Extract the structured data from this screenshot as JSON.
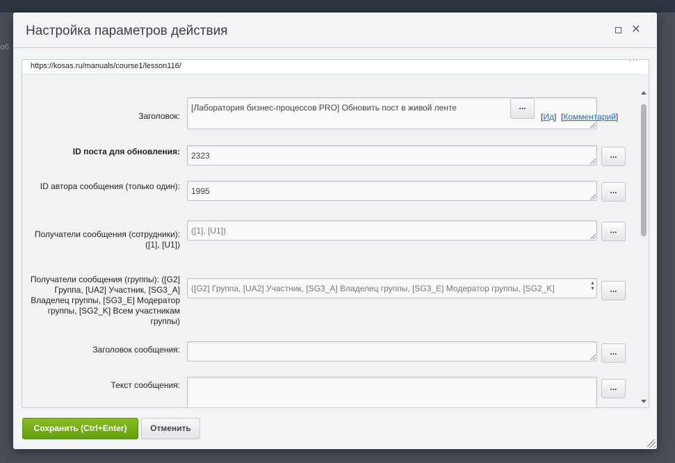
{
  "background": {
    "partial_text": "лоб"
  },
  "dialog": {
    "title": "Настройка параметров действия",
    "maximize_glyph": "□",
    "close_glyph": "✕",
    "dots_glyph": "···"
  },
  "url": "https://kosas.ru/manuals/course1/lesson116/",
  "fields": {
    "title": {
      "label": "Заголовок:",
      "value": "[Лаборатория бизнес-процессов PRO] Обновить пост в живой ленте",
      "button": "...",
      "link_id": "Ид",
      "link_comment": "Комментарий"
    },
    "post_id": {
      "label": "ID поста для обновления:",
      "value": "2323",
      "button": "..."
    },
    "author_id": {
      "label": "ID автора сообщения (только один):",
      "value": "1995",
      "button": "..."
    },
    "recipients_users": {
      "label": "Получатели сообщения (сотрудники): ([1], [U1])",
      "placeholder": "([1], [U1])",
      "button": "..."
    },
    "recipients_groups": {
      "label": "Получатели сообщения (группы): ([G2] Группа, [UA2] Участник, [SG3_A] Владелец группы, [SG3_E] Модератор группы, [SG2_K] Всем участникам группы)",
      "placeholder": "([G2] Группа, [UA2] Участник, [SG3_A] Владелец группы, [SG3_E] Модератор группы,  [SG2_K]",
      "button": "..."
    },
    "message_title": {
      "label": "Заголовок сообщения:",
      "value": "",
      "button": "..."
    },
    "message_text": {
      "label": "Текст сообщения:",
      "value": "",
      "button": "..."
    }
  },
  "footer": {
    "save_label": "Сохранить (Ctrl+Enter)",
    "cancel_label": "Отменить"
  },
  "colors": {
    "save_button": "#74ab18",
    "link": "#2a6bc0"
  }
}
